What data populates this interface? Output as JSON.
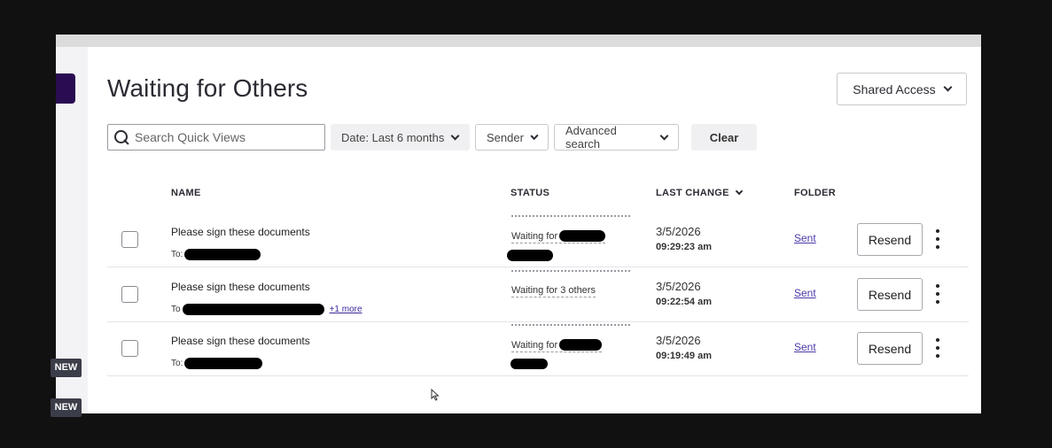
{
  "header": {
    "title": "Waiting for Others",
    "shared_access_label": "Shared Access"
  },
  "filters": {
    "search_placeholder": "Search Quick Views",
    "date_label": "Date: Last 6 months",
    "sender_label": "Sender",
    "advanced_label": "Advanced search",
    "clear_label": "Clear"
  },
  "table": {
    "columns": {
      "name": "NAME",
      "status": "STATUS",
      "last_change": "LAST CHANGE",
      "folder": "FOLDER"
    },
    "rows": [
      {
        "subject": "Please sign these documents",
        "to_prefix": "To:",
        "more": "",
        "status": "Waiting for",
        "date": "3/5/2026",
        "time": "09:29:23 am",
        "folder": "Sent",
        "action": "Resend"
      },
      {
        "subject": "Please sign these documents",
        "to_prefix": "To",
        "more": "+1 more",
        "status": "Waiting for 3 others",
        "date": "3/5/2026",
        "time": "09:22:54 am",
        "folder": "Sent",
        "action": "Resend"
      },
      {
        "subject": "Please sign these documents",
        "to_prefix": "To:",
        "more": "",
        "status": "Waiting for",
        "date": "3/5/2026",
        "time": "09:19:49 am",
        "folder": "Sent",
        "action": "Resend"
      }
    ]
  },
  "sidebar": {
    "badges": [
      "NEW",
      "NEW"
    ]
  },
  "colors": {
    "rail_accent": "#2a0c52",
    "link": "#4a3aa8",
    "badge_bg": "#3b3d48"
  }
}
